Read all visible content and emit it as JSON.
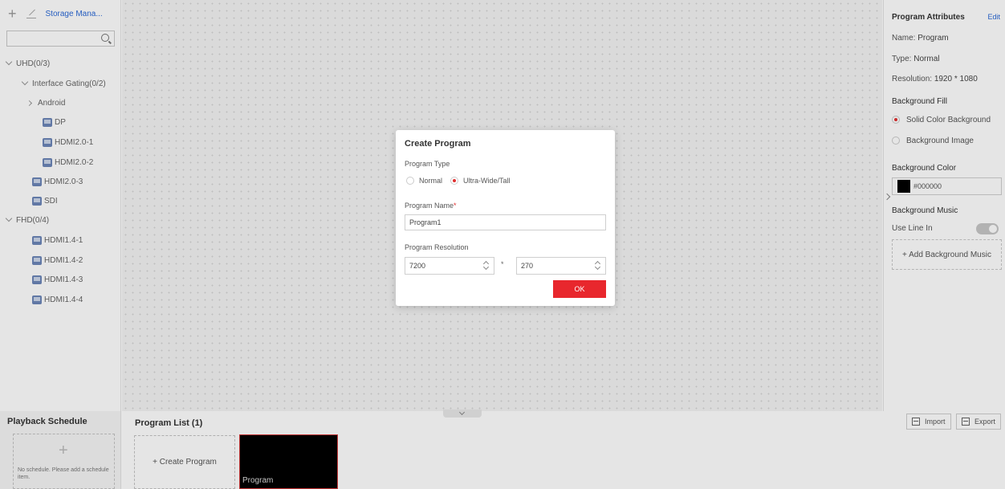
{
  "left_panel": {
    "storage_label": "Storage Mana...",
    "search_placeholder": "",
    "tree": [
      {
        "label": "UHD(0/3)"
      },
      {
        "label": "Interface Gating(0/2)"
      },
      {
        "label": "Android"
      },
      {
        "label": "DP"
      },
      {
        "label": "HDMI2.0-1"
      },
      {
        "label": "HDMI2.0-2"
      },
      {
        "label": "HDMI2.0-3"
      },
      {
        "label": "SDI"
      },
      {
        "label": "FHD(0/4)"
      },
      {
        "label": "HDMI1.4-1"
      },
      {
        "label": "HDMI1.4-2"
      },
      {
        "label": "HDMI1.4-3"
      },
      {
        "label": "HDMI1.4-4"
      }
    ]
  },
  "right_panel": {
    "title": "Program Attributes",
    "edit": "Edit",
    "name_label": "Name:",
    "name_value": "Program",
    "type_label": "Type:",
    "type_value": "Normal",
    "resolution_label": "Resolution:",
    "resolution_value": "1920 * 1080",
    "bg_fill_label": "Background Fill",
    "bg_solid": "Solid Color Background",
    "bg_image": "Background Image",
    "bg_color_label": "Background Color",
    "bg_color_value": "#000000",
    "bg_music_label": "Background Music",
    "line_in_label": "Use Line In",
    "add_music": "+ Add Background Music"
  },
  "bottom": {
    "playback_title": "Playback Schedule",
    "playback_empty": "No schedule. Please add a schedule item.",
    "program_list_title": "Program List  (1)",
    "create_program": "+ Create Program",
    "program_card_label": "Program",
    "import": "Import",
    "export": "Export"
  },
  "modal": {
    "title": "Create Program",
    "type_label": "Program Type",
    "type_normal": "Normal",
    "type_ultra": "Ultra-Wide/Tall",
    "name_label": "Program Name",
    "name_value": "Program1",
    "resolution_label": "Program Resolution",
    "width": "7200",
    "height": "270",
    "times": "*",
    "ok": "OK"
  },
  "colors": {
    "accent_red": "#e8272d",
    "link_blue": "#2a68d6"
  }
}
